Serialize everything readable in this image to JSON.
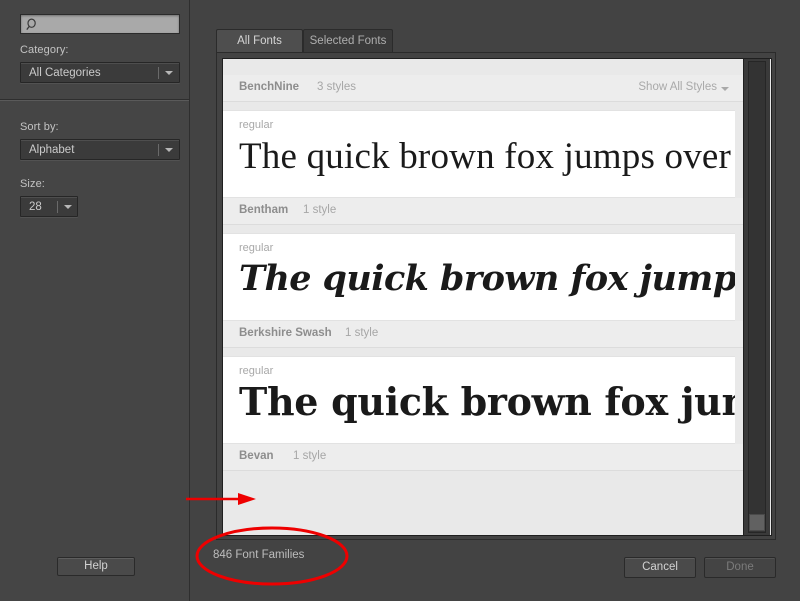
{
  "window": {
    "background": "#434343"
  },
  "sidebar": {
    "search": {
      "icon": "search-icon",
      "value": "",
      "placeholder": ""
    },
    "category": {
      "label": "Category:",
      "value": "All Categories"
    },
    "sort": {
      "label": "Sort by:",
      "value": "Alphabet"
    },
    "size": {
      "label": "Size:",
      "value": "28"
    },
    "help_label": "Help"
  },
  "tabs": [
    {
      "label": "All Fonts",
      "active": true
    },
    {
      "label": "Selected Fonts",
      "active": false
    }
  ],
  "list": {
    "show_all_styles_label": "Show All Styles",
    "families": [
      {
        "name": "BenchNine",
        "styles": "3 styles",
        "has_show_all": true
      },
      {
        "name": "Bentham",
        "styles": "1 style",
        "has_show_all": false
      },
      {
        "name": "Berkshire Swash",
        "styles": "1 style",
        "has_show_all": false
      },
      {
        "name": "Bevan",
        "styles": "1 style",
        "has_show_all": false
      }
    ],
    "samples": [
      {
        "style_label": "regular",
        "text": "The quick brown fox jumps over the laz"
      },
      {
        "style_label": "regular",
        "text": "The quick brown fox jumps over the laz"
      },
      {
        "style_label": "regular",
        "text": "The quick brown fox jumps ov"
      }
    ]
  },
  "footer": {
    "status": "846 Font Families",
    "cancel_label": "Cancel",
    "done_label": "Done"
  },
  "annotations": {
    "color": "#ee0000",
    "arrow_target": "Bevan",
    "ellipse_target": "846 Font Families"
  }
}
